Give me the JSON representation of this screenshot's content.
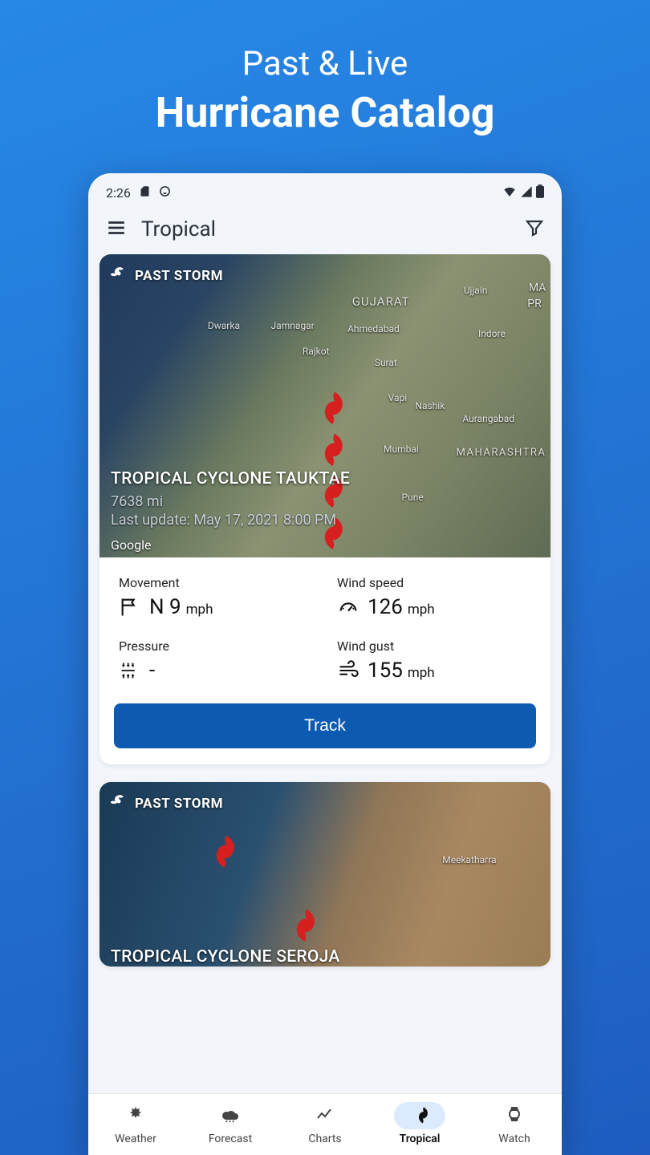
{
  "promo": {
    "line1": "Past & Live",
    "line2": "Hurricane Catalog"
  },
  "status": {
    "time": "2:26"
  },
  "header": {
    "title": "Tropical"
  },
  "storms": [
    {
      "badge": "PAST STORM",
      "name": "TROPICAL CYCLONE TAUKTAE",
      "distance": "7638 mi",
      "last_update": "Last update: May 17, 2021 8:00 PM",
      "map_attrib": "Google",
      "stats": {
        "movement": {
          "label": "Movement",
          "value": "N 9",
          "unit": "mph"
        },
        "wind_speed": {
          "label": "Wind speed",
          "value": "126",
          "unit": "mph"
        },
        "pressure": {
          "label": "Pressure",
          "value": "-",
          "unit": ""
        },
        "wind_gust": {
          "label": "Wind gust",
          "value": "155",
          "unit": "mph"
        }
      },
      "track_label": "Track"
    },
    {
      "badge": "PAST STORM",
      "name": "TROPICAL CYCLONE SEROJA"
    }
  ],
  "map_labels": {
    "gujarat": "GUJARAT",
    "ahmedabad": "Ahmedabad",
    "dwarka": "Dwarka",
    "jamnagar": "Jamnagar",
    "rajkot": "Rajkot",
    "surat": "Surat",
    "vapi": "Vapi",
    "nashik": "Nashik",
    "mumbai": "Mumbai",
    "pune": "Pune",
    "ujjain": "Ujjain",
    "indore": "Indore",
    "aurangabad": "Aurangabad",
    "maharashtra": "MAHARASHTRA",
    "ma": "MA",
    "pr": "PR",
    "meekatharra": "Meekatharra"
  },
  "nav": [
    {
      "label": "Weather"
    },
    {
      "label": "Forecast"
    },
    {
      "label": "Charts"
    },
    {
      "label": "Tropical"
    },
    {
      "label": "Watch"
    }
  ]
}
